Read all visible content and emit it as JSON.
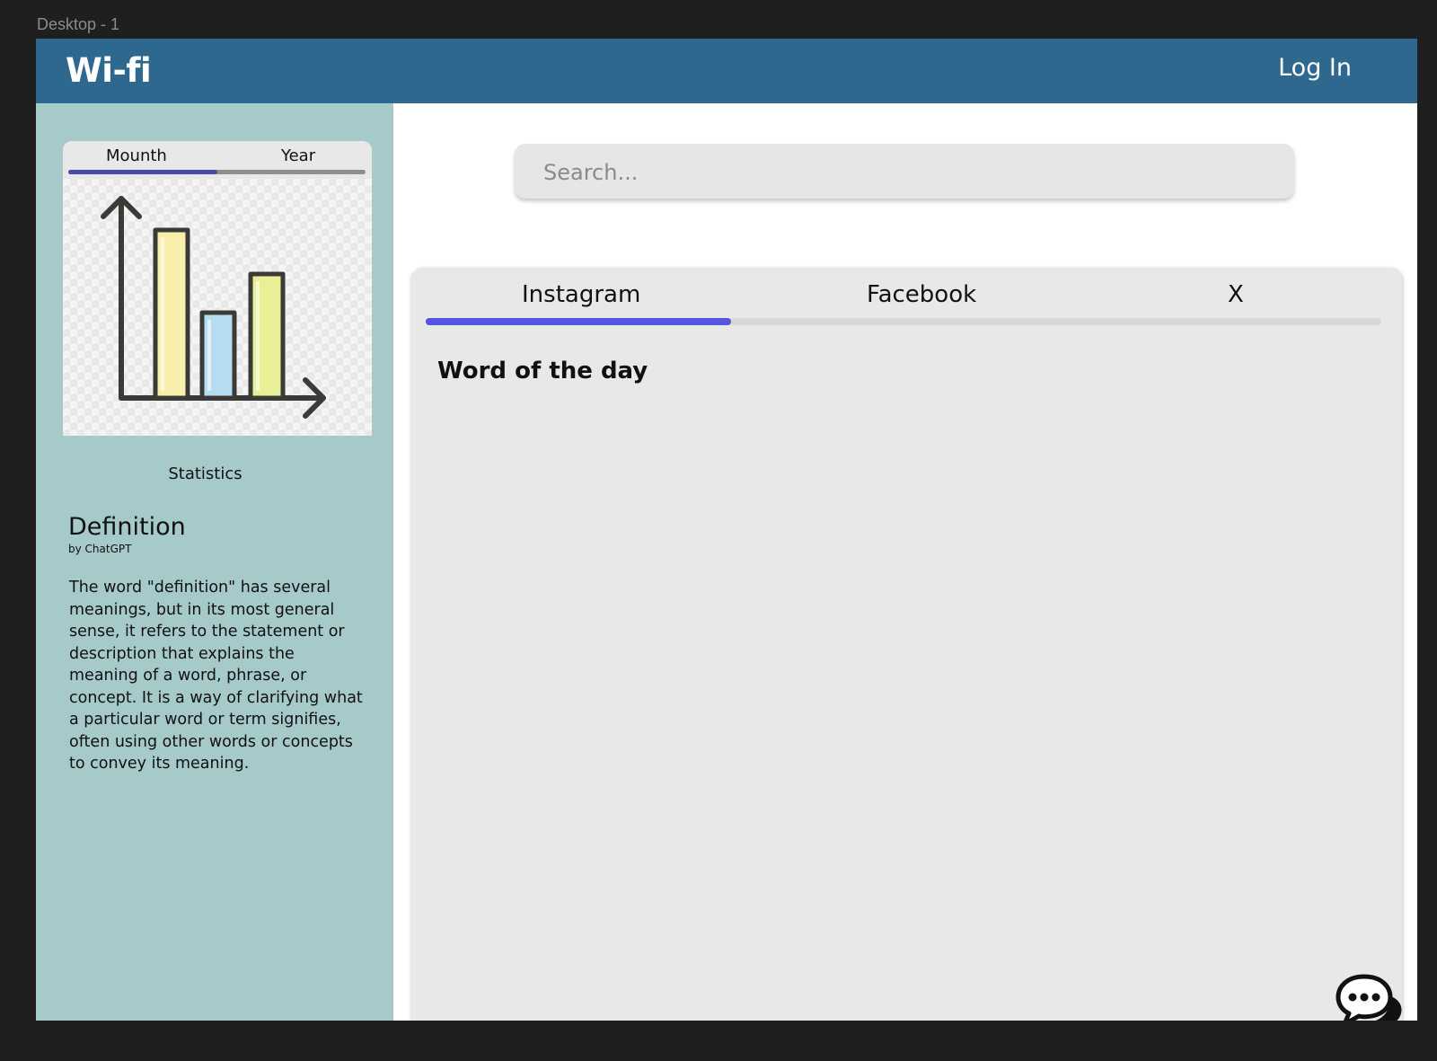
{
  "frame": {
    "label": "Desktop - 1"
  },
  "header": {
    "brand": "Wi-fi",
    "login_label": "Log In"
  },
  "sidebar": {
    "stats_tabs": [
      "Mounth",
      "Year"
    ],
    "stats_tab_progress": 0.5,
    "stats_caption": "Statistics",
    "definition": {
      "title": "Definition",
      "byline": "by ChatGPT",
      "text": "The word \"definition\" has several meanings, but in its most general sense, it refers to the statement or description that explains the meaning of a word, phrase, or concept. It is a way of clarifying what a particular word or term signifies, often using other words or concepts to convey its meaning."
    }
  },
  "search": {
    "placeholder": "Search...",
    "value": ""
  },
  "panel": {
    "tabs": [
      "Instagram",
      "Facebook",
      "X"
    ],
    "tab_progress": 0.32,
    "heading": "Word of the day"
  },
  "colors": {
    "background": "#1f1f1f",
    "header": "#2f688f",
    "sidebar": "#a6c9ca",
    "panel": "#e8e8e8",
    "tab_indicator": "#5454e0",
    "stats_indicator": "#4a4aa8"
  },
  "icons": {
    "stats_image": "bar-chart-icon",
    "chat": "chat-bubbles-icon"
  }
}
